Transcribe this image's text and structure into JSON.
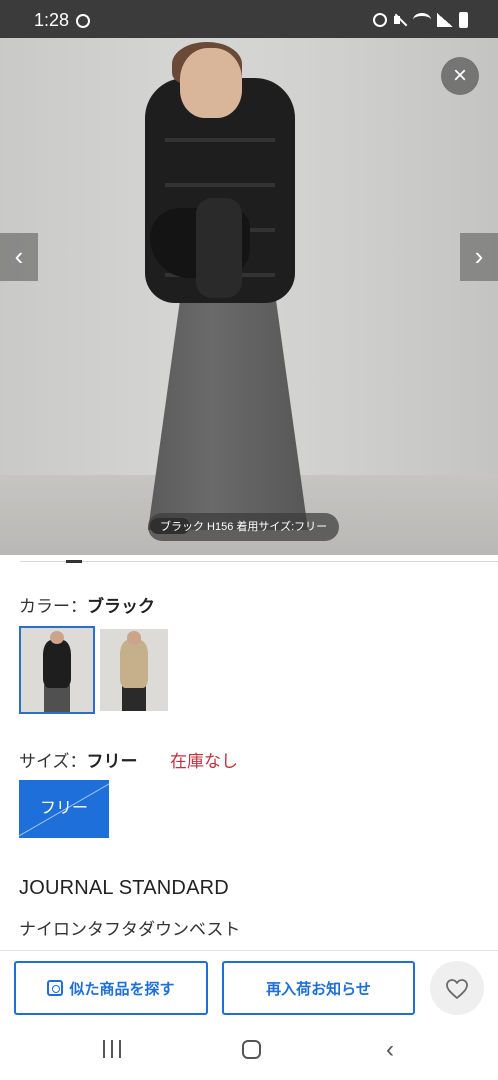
{
  "status_bar": {
    "time": "1:28",
    "icons": [
      "sync-icon",
      "alarm-icon",
      "mute-icon",
      "wifi-icon",
      "signal-icon",
      "battery-icon"
    ]
  },
  "gallery": {
    "caption": "ブラック H156 着用サイズ:フリー",
    "close_icon": "×",
    "prev_icon": "‹",
    "next_icon": "›"
  },
  "color": {
    "label": "カラー：",
    "selected": "ブラック",
    "swatches": [
      {
        "name": "ブラック",
        "tone": "#1e1e1e",
        "selected": true
      },
      {
        "name": "ベージュ",
        "tone": "#c6b08c",
        "selected": false
      }
    ]
  },
  "size": {
    "label": "サイズ：",
    "selected": "フリー",
    "stock_status": "在庫なし",
    "options": [
      {
        "label": "フリー",
        "available": false
      }
    ]
  },
  "product": {
    "brand": "JOURNAL STANDARD",
    "name": "ナイロンタフタダウンベスト"
  },
  "actions": {
    "similar_label": "似た商品を探す",
    "restock_label": "再入荷お知らせ"
  },
  "colors": {
    "accent": "#1e6fd9",
    "stock_alert": "#c4303c"
  }
}
